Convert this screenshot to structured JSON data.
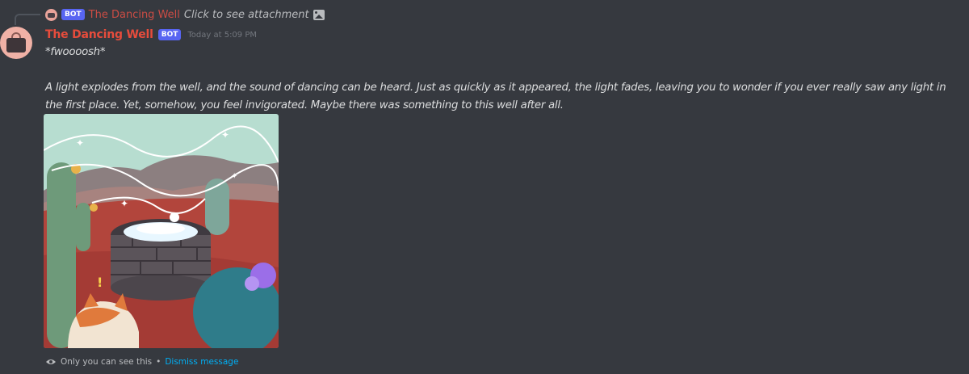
{
  "reply": {
    "bot_tag": "BOT",
    "author": "The Dancing Well",
    "text": "Click to see attachment",
    "icon": "image-icon"
  },
  "message": {
    "author": "The Dancing Well",
    "bot_tag": "BOT",
    "timestamp": "Today at 5:09 PM",
    "line1": "*fwoooosh*",
    "paragraph": "A light explodes from the well, and the sound of dancing can be heard. Just as quickly as it appeared, the light fades, leaving you to wonder if you ever really saw any light in the first place. Yet, somehow, you feel invigorated. Maybe there was something to this well after all.",
    "author_color": "#e74c3c"
  },
  "footer": {
    "notice": "Only you can see this",
    "separator": "•",
    "dismiss": "Dismiss message",
    "icon": "eye-icon"
  }
}
